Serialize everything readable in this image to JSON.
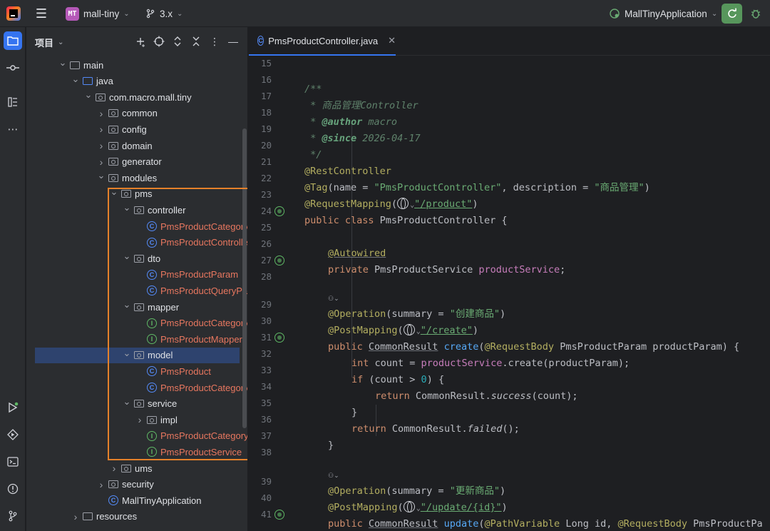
{
  "titlebar": {
    "project_badge": "MT",
    "project_name": "mall-tiny",
    "branch": "3.x",
    "run_config": "MallTinyApplication"
  },
  "project_panel": {
    "title": "项目",
    "tree": [
      {
        "label": "main",
        "depth": 0,
        "expanded": true,
        "kind": "folder"
      },
      {
        "label": "java",
        "depth": 1,
        "expanded": true,
        "kind": "folder-blue"
      },
      {
        "label": "com.macro.mall.tiny",
        "depth": 2,
        "expanded": true,
        "kind": "package"
      },
      {
        "label": "common",
        "depth": 3,
        "expanded": false,
        "kind": "package"
      },
      {
        "label": "config",
        "depth": 3,
        "expanded": false,
        "kind": "package"
      },
      {
        "label": "domain",
        "depth": 3,
        "expanded": false,
        "kind": "package"
      },
      {
        "label": "generator",
        "depth": 3,
        "expanded": false,
        "kind": "package"
      },
      {
        "label": "modules",
        "depth": 3,
        "expanded": true,
        "kind": "package"
      },
      {
        "label": "pms",
        "depth": 4,
        "expanded": true,
        "kind": "package"
      },
      {
        "label": "controller",
        "depth": 5,
        "expanded": true,
        "kind": "package"
      },
      {
        "label": "PmsProductCategoryController",
        "depth": 6,
        "kind": "class"
      },
      {
        "label": "PmsProductController",
        "depth": 6,
        "kind": "class"
      },
      {
        "label": "dto",
        "depth": 5,
        "expanded": true,
        "kind": "package"
      },
      {
        "label": "PmsProductParam",
        "depth": 6,
        "kind": "class"
      },
      {
        "label": "PmsProductQueryParam",
        "depth": 6,
        "kind": "class"
      },
      {
        "label": "mapper",
        "depth": 5,
        "expanded": true,
        "kind": "package"
      },
      {
        "label": "PmsProductCategoryMapper",
        "depth": 6,
        "kind": "interface"
      },
      {
        "label": "PmsProductMapper",
        "depth": 6,
        "kind": "interface"
      },
      {
        "label": "model",
        "depth": 5,
        "expanded": true,
        "kind": "package",
        "selected": true
      },
      {
        "label": "PmsProduct",
        "depth": 6,
        "kind": "class"
      },
      {
        "label": "PmsProductCategory",
        "depth": 6,
        "kind": "class"
      },
      {
        "label": "service",
        "depth": 5,
        "expanded": true,
        "kind": "package"
      },
      {
        "label": "impl",
        "depth": 6,
        "expanded": false,
        "kind": "package"
      },
      {
        "label": "PmsProductCategoryService",
        "depth": 6,
        "kind": "interface"
      },
      {
        "label": "PmsProductService",
        "depth": 6,
        "kind": "interface"
      },
      {
        "label": "ums",
        "depth": 4,
        "expanded": false,
        "kind": "package"
      },
      {
        "label": "security",
        "depth": 3,
        "expanded": false,
        "kind": "package"
      },
      {
        "label": "MallTinyApplication",
        "depth": 3,
        "kind": "app"
      },
      {
        "label": "resources",
        "depth": 1,
        "expanded": false,
        "kind": "resources"
      }
    ]
  },
  "editor": {
    "tab_label": "PmsProductController.java",
    "line_numbers": [
      "15",
      "16",
      "17",
      "18",
      "19",
      "20",
      "21",
      "22",
      "23",
      "24",
      "25",
      "26",
      "27",
      "28",
      "",
      "29",
      "30",
      "31",
      "32",
      "33",
      "34",
      "35",
      "36",
      "37",
      "38",
      "",
      "39",
      "40",
      "41"
    ],
    "code": {
      "l16": "/**",
      "l17_star": " * ",
      "l17_text": "商品管理Controller",
      "l18_star": " * ",
      "l18_tag": "@author",
      "l18_text": " macro",
      "l19_star": " * ",
      "l19_tag": "@since",
      "l19_text": " 2026-04-17",
      "l20": " */",
      "l21": "@RestController",
      "l22_ann": "@Tag",
      "l22_a": "(name = ",
      "l22_s1": "\"PmsProductController\"",
      "l22_b": ", description = ",
      "l22_s2": "\"商品管理\"",
      "l22_c": ")",
      "l23_ann": "@RequestMapping",
      "l23_a": "(",
      "l23_s": "\"/product\"",
      "l23_b": ")",
      "l24_kw": "public class ",
      "l24_name": "PmsProductController {",
      "l26": "@Autowired",
      "l27_kw": "private ",
      "l27_type": "PmsProductService ",
      "l27_fld": "productService",
      "l27_end": ";",
      "inlay": "⚇⌄",
      "l29_ann": "@Operation",
      "l29_a": "(summary = ",
      "l29_s": "\"创建商品\"",
      "l29_b": ")",
      "l30_ann": "@PostMapping",
      "l30_a": "(",
      "l30_s": "\"/create\"",
      "l30_b": ")",
      "l31_kw": "public ",
      "l31_type": "CommonResult",
      "l31_sp": " ",
      "l31_mth": "create",
      "l31_a": "(",
      "l31_ann": "@RequestBody",
      "l31_b": " PmsProductParam productParam) {",
      "l32_kw": "int ",
      "l32_a": "count = ",
      "l32_fld": "productService",
      "l32_b": ".create(productParam);",
      "l33_kw": "if ",
      "l33_a": "(count > ",
      "l33_num": "0",
      "l33_b": ") {",
      "l34_kw": "return ",
      "l34_a": "CommonResult.",
      "l34_it": "success",
      "l34_b": "(count);",
      "l35": "}",
      "l36_kw": "return ",
      "l36_a": "CommonResult.",
      "l36_it": "failed",
      "l36_b": "();",
      "l37": "}",
      "l39_ann": "@Operation",
      "l39_a": "(summary = ",
      "l39_s": "\"更新商品\"",
      "l39_b": ")",
      "l40_ann": "@PostMapping",
      "l40_a": "(",
      "l40_s": "\"/update/{id}\"",
      "l40_b": ")",
      "l41_kw": "public ",
      "l41_type": "CommonResult",
      "l41_sp": " ",
      "l41_mth": "update",
      "l41_a": "(",
      "l41_ann1": "@PathVariable",
      "l41_b": " Long id, ",
      "l41_ann2": "@RequestBody",
      "l41_c": " PmsProductPa"
    }
  },
  "colors": {
    "accent": "#3574f0",
    "highlight_box": "#e5812a",
    "run_button": "#57965c"
  }
}
